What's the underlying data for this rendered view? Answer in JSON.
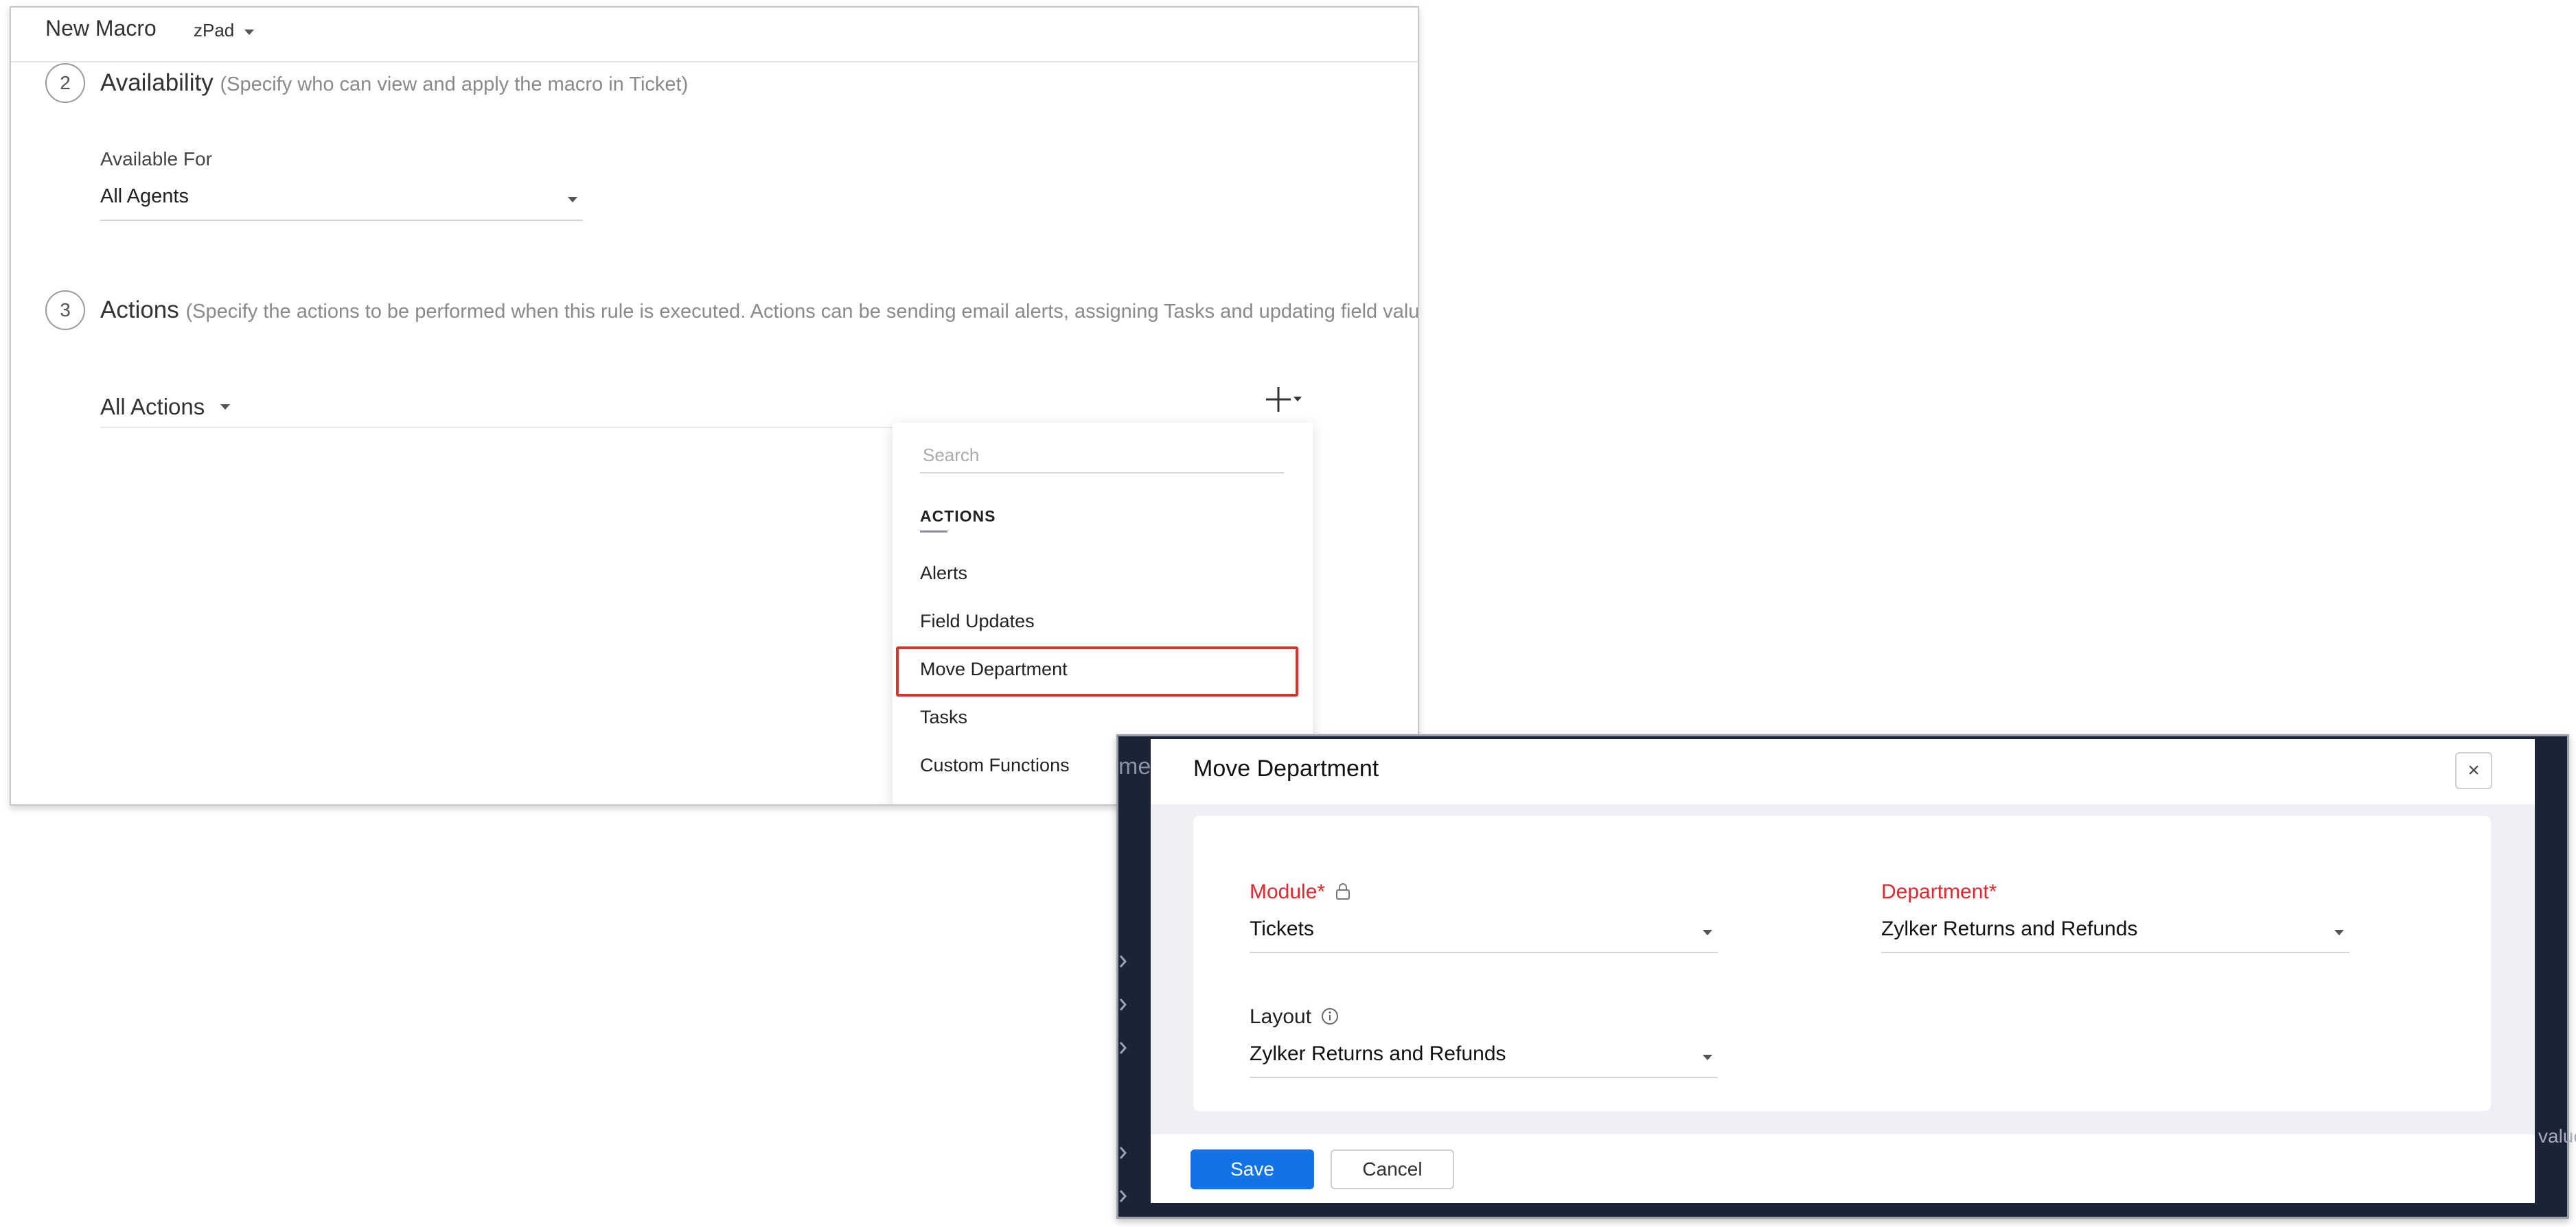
{
  "macro": {
    "title": "New Macro",
    "module": "zPad",
    "availability": {
      "step": "2",
      "title": "Availability",
      "description": "(Specify who can view and apply the macro in Ticket)",
      "available_for_label": "Available For",
      "available_for_value": "All Agents"
    },
    "actions": {
      "step": "3",
      "title": "Actions",
      "description": "(Specify the actions to be performed when this rule is executed. Actions can be sending email alerts, assigning Tasks and updating field values)",
      "all_actions_label": "All Actions"
    },
    "dropdown": {
      "search_placeholder": "Search",
      "heading": "ACTIONS",
      "items": [
        {
          "label": "Alerts"
        },
        {
          "label": "Field Updates"
        },
        {
          "label": "Move Department",
          "highlighted": true
        },
        {
          "label": "Tasks"
        },
        {
          "label": "Custom Functions"
        }
      ]
    }
  },
  "dialog": {
    "title": "Move Department",
    "close_symbol": "×",
    "module_label": "Module",
    "module_value": "Tickets",
    "department_label": "Department",
    "department_value": "Zylker Returns and Refunds",
    "layout_label": "Layout",
    "layout_value": "Zylker Returns and Refunds",
    "required_marker": "*",
    "save_label": "Save",
    "cancel_label": "Cancel"
  },
  "background_fragments": {
    "left_text": "me",
    "right_text": "value"
  },
  "colors": {
    "accent_blue": "#1273e6",
    "required_red": "#e3272d",
    "highlight_red": "#d9342b",
    "backdrop_navy": "#1b2337"
  }
}
